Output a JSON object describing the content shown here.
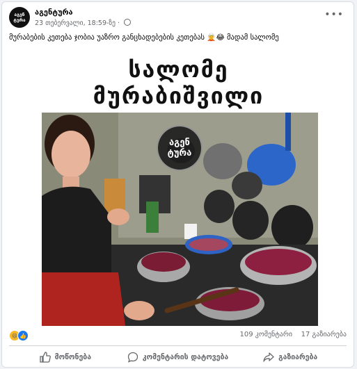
{
  "post": {
    "page_name": "აგენტურა",
    "timestamp": "23 თებერვალი, 18:59-ზე",
    "avatar_text_top": "აგენ",
    "avatar_text_bottom": "ტურა",
    "caption": "მურაბების კეთება ჯობია უაზრო განცხადებების კეთებას 🧝😂 მადამ სალომე"
  },
  "image": {
    "headline_line1": "სალომე",
    "headline_line2": "მურაბიშვილი",
    "watermark_top": "აგენ",
    "watermark_bottom": "ტურა"
  },
  "stats": {
    "reactions": [
      "haha",
      "like"
    ],
    "comments": "109 კომენტარი",
    "shares": "17 გაზიარება"
  },
  "actions": {
    "like": "მოწონება",
    "comment": "კომენტარის დატოვება",
    "share": "გაზიარება"
  }
}
